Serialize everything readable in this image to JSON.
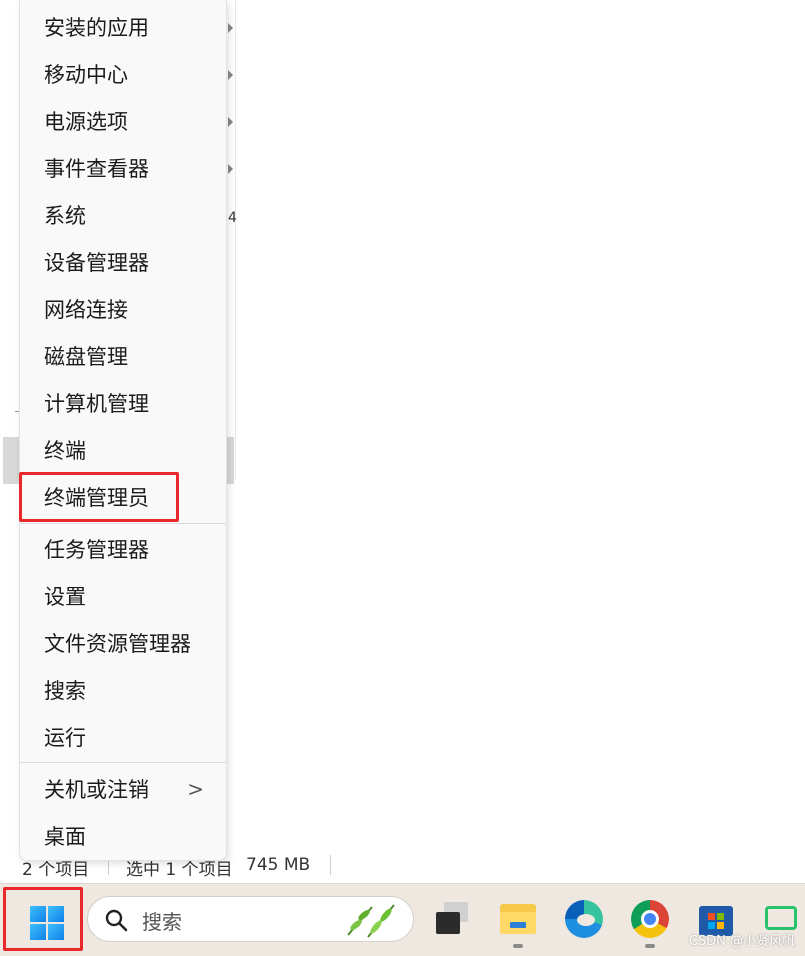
{
  "context_menu": {
    "items": [
      {
        "label": "安装的应用",
        "has_submenu": true
      },
      {
        "label": "移动中心",
        "has_submenu": true
      },
      {
        "label": "电源选项",
        "has_submenu": true
      },
      {
        "label": "事件查看器",
        "has_submenu": true
      },
      {
        "label": "系统",
        "has_submenu": false
      },
      {
        "label": "设备管理器",
        "has_submenu": false
      },
      {
        "label": "网络连接",
        "has_submenu": false
      },
      {
        "label": "磁盘管理",
        "has_submenu": false
      },
      {
        "label": "计算机管理",
        "has_submenu": false
      },
      {
        "label": "终端",
        "has_submenu": false
      },
      {
        "label": "终端管理员",
        "has_submenu": false
      },
      {
        "label": "任务管理器",
        "has_submenu": false
      },
      {
        "label": "设置",
        "has_submenu": false
      },
      {
        "label": "文件资源管理器",
        "has_submenu": false
      },
      {
        "label": "搜索",
        "has_submenu": false
      },
      {
        "label": "运行",
        "has_submenu": false
      },
      {
        "label": "关机或注销",
        "has_submenu": true
      },
      {
        "label": "桌面",
        "has_submenu": false
      }
    ],
    "chevron": ">",
    "highlighted_item": "终端管理员"
  },
  "background": {
    "fragment": "4"
  },
  "status_bar": {
    "item_count": "2 个项目",
    "selected": "选中 1 个项目",
    "size": "745 MB"
  },
  "taskbar": {
    "search_placeholder": "搜索",
    "apps": [
      "task-view-icon",
      "file-explorer-icon",
      "edge-icon",
      "chrome-icon",
      "store-icon",
      "remote-icon"
    ]
  },
  "watermark": "CSDN @小贤风帆",
  "colors": {
    "highlight_border": "#e8282a",
    "taskbar_bg": "#efe8e1",
    "menu_bg": "#f9f9f9"
  }
}
